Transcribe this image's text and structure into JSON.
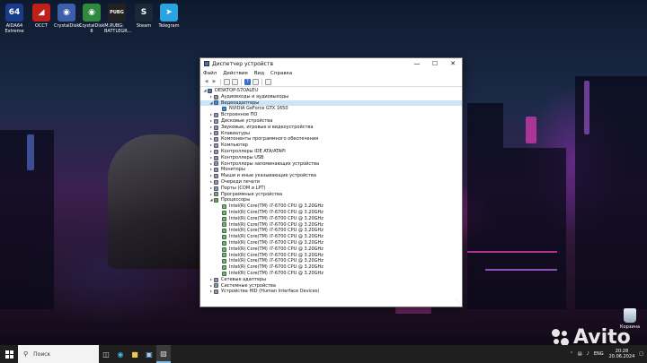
{
  "desktop": {
    "icons": [
      {
        "label": "AIDA64 Extreme",
        "glyph": "64",
        "color": "#1a3a8a"
      },
      {
        "label": "OCCT",
        "glyph": "◢",
        "color": "#c0201a"
      },
      {
        "label": "CrystalDiskI...",
        "glyph": "◉",
        "color": "#3b5fa8"
      },
      {
        "label": "CrystalDiskM... 8",
        "glyph": "◉",
        "color": "#2e8a3e"
      },
      {
        "label": "PUBG: BATTLEGR...",
        "glyph": "PUBG",
        "color": "#222222"
      },
      {
        "label": "Steam",
        "glyph": "S",
        "color": "#1b2838"
      },
      {
        "label": "Telegram",
        "glyph": "➤",
        "color": "#2aa3e0"
      }
    ],
    "recycle_bin": "Корзина"
  },
  "window": {
    "title": "Диспетчер устройств",
    "menu": [
      "Файл",
      "Действие",
      "Вид",
      "Справка"
    ],
    "tree": [
      {
        "label": "DESKTOP-S7OALEU",
        "level": 0,
        "expanded": true,
        "icon": "computer-icon"
      },
      {
        "label": "Аудиовходы и аудиовыходы",
        "level": 1,
        "expanded": false,
        "icon": "audio-icon"
      },
      {
        "label": "Видеоадаптеры",
        "level": 1,
        "expanded": true,
        "icon": "display-adapter-icon",
        "selected": true
      },
      {
        "label": "NVIDIA GeForce GTX 1650",
        "level": 2,
        "icon": "display-adapter-icon"
      },
      {
        "label": "Встроенное ПО",
        "level": 1,
        "expanded": false,
        "icon": "firmware-icon"
      },
      {
        "label": "Дисковые устройства",
        "level": 1,
        "expanded": false,
        "icon": "disk-icon"
      },
      {
        "label": "Звуковые, игровые и видеоустройства",
        "level": 1,
        "expanded": false,
        "icon": "sound-icon"
      },
      {
        "label": "Клавиатуры",
        "level": 1,
        "expanded": false,
        "icon": "keyboard-icon"
      },
      {
        "label": "Компоненты программного обеспечения",
        "level": 1,
        "expanded": false,
        "icon": "software-component-icon"
      },
      {
        "label": "Компьютер",
        "level": 1,
        "expanded": false,
        "icon": "computer-icon"
      },
      {
        "label": "Контроллеры IDE ATA/ATAPI",
        "level": 1,
        "expanded": false,
        "icon": "ide-icon"
      },
      {
        "label": "Контроллеры USB",
        "level": 1,
        "expanded": false,
        "icon": "usb-icon"
      },
      {
        "label": "Контроллеры запоминающих устройства",
        "level": 1,
        "expanded": false,
        "icon": "storage-controller-icon"
      },
      {
        "label": "Мониторы",
        "level": 1,
        "expanded": false,
        "icon": "monitor-icon"
      },
      {
        "label": "Мыши и иные указывающие устройства",
        "level": 1,
        "expanded": false,
        "icon": "mouse-icon"
      },
      {
        "label": "Очереди печати",
        "level": 1,
        "expanded": false,
        "icon": "printer-icon"
      },
      {
        "label": "Порты (COM и LPT)",
        "level": 1,
        "expanded": false,
        "icon": "port-icon"
      },
      {
        "label": "Программные устройства",
        "level": 1,
        "expanded": false,
        "icon": "software-device-icon"
      },
      {
        "label": "Процессоры",
        "level": 1,
        "expanded": true,
        "icon": "processor-icon"
      },
      {
        "label": "Intel(R) Core(TM) i7-6700 CPU @ 3.20GHz",
        "level": 2,
        "icon": "cpu-icon"
      },
      {
        "label": "Intel(R) Core(TM) i7-6700 CPU @ 3.20GHz",
        "level": 2,
        "icon": "cpu-icon"
      },
      {
        "label": "Intel(R) Core(TM) i7-6700 CPU @ 3.20GHz",
        "level": 2,
        "icon": "cpu-icon"
      },
      {
        "label": "Intel(R) Core(TM) i7-6700 CPU @ 3.20GHz",
        "level": 2,
        "icon": "cpu-icon"
      },
      {
        "label": "Intel(R) Core(TM) i7-6700 CPU @ 3.20GHz",
        "level": 2,
        "icon": "cpu-icon"
      },
      {
        "label": "Intel(R) Core(TM) i7-6700 CPU @ 3.20GHz",
        "level": 2,
        "icon": "cpu-icon"
      },
      {
        "label": "Intel(R) Core(TM) i7-6700 CPU @ 3.20GHz",
        "level": 2,
        "icon": "cpu-icon"
      },
      {
        "label": "Intel(R) Core(TM) i7-6700 CPU @ 3.20GHz",
        "level": 2,
        "icon": "cpu-icon"
      },
      {
        "label": "Intel(R) Core(TM) i7-6700 CPU @ 3.20GHz",
        "level": 2,
        "icon": "cpu-icon"
      },
      {
        "label": "Intel(R) Core(TM) i7-6700 CPU @ 3.20GHz",
        "level": 2,
        "icon": "cpu-icon"
      },
      {
        "label": "Intel(R) Core(TM) i7-6700 CPU @ 3.20GHz",
        "level": 2,
        "icon": "cpu-icon"
      },
      {
        "label": "Intel(R) Core(TM) i7-6700 CPU @ 3.20GHz",
        "level": 2,
        "icon": "cpu-icon"
      },
      {
        "label": "Сетевые адаптеры",
        "level": 1,
        "expanded": false,
        "icon": "network-adapter-icon"
      },
      {
        "label": "Системные устройства",
        "level": 1,
        "expanded": false,
        "icon": "system-device-icon"
      },
      {
        "label": "Устройства HID (Human Interface Devices)",
        "level": 1,
        "expanded": false,
        "icon": "hid-icon"
      }
    ]
  },
  "taskbar": {
    "search_placeholder": "Поиск",
    "language": "ENG",
    "time": "20:28",
    "date": "20.06.2024"
  },
  "watermark": "Avito",
  "colors": {
    "selection": "#cce4f7",
    "taskbar": "#1f1f1f",
    "accent": "#76b9ed"
  }
}
